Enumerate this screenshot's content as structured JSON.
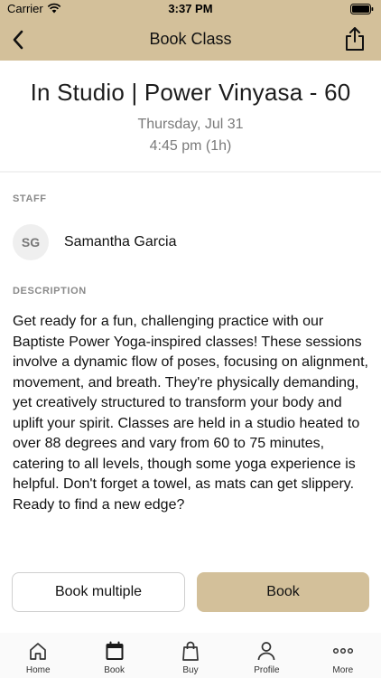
{
  "status_bar": {
    "carrier": "Carrier",
    "time": "3:37 PM"
  },
  "nav": {
    "title": "Book Class"
  },
  "class": {
    "title": "In Studio | Power Vinyasa - 60",
    "date": "Thursday, Jul 31",
    "time": "4:45 pm (1h)"
  },
  "staff": {
    "section_label": "STAFF",
    "initials": "SG",
    "name": "Samantha Garcia"
  },
  "description": {
    "section_label": "DESCRIPTION",
    "text": "Get ready for a fun, challenging practice with our Baptiste Power Yoga-inspired classes! These sessions involve a dynamic flow of poses, focusing on alignment, movement, and breath. They're physically demanding, yet creatively structured to transform your body and uplift your spirit. Classes are held in a studio heated to over 88 degrees and vary from 60 to 75 minutes, catering to all levels, though some yoga experience is helpful. Don't forget a towel, as mats can get slippery. Ready to find a new edge?"
  },
  "actions": {
    "book_multiple": "Book multiple",
    "book": "Book"
  },
  "tabs": [
    {
      "label": "Home",
      "icon": "home-icon"
    },
    {
      "label": "Book",
      "icon": "calendar-icon"
    },
    {
      "label": "Buy",
      "icon": "shopping-bag-icon"
    },
    {
      "label": "Profile",
      "icon": "person-icon"
    },
    {
      "label": "More",
      "icon": "more-dots-icon"
    }
  ],
  "colors": {
    "accent": "#d3c09a",
    "muted_text": "#7a7a7a"
  }
}
